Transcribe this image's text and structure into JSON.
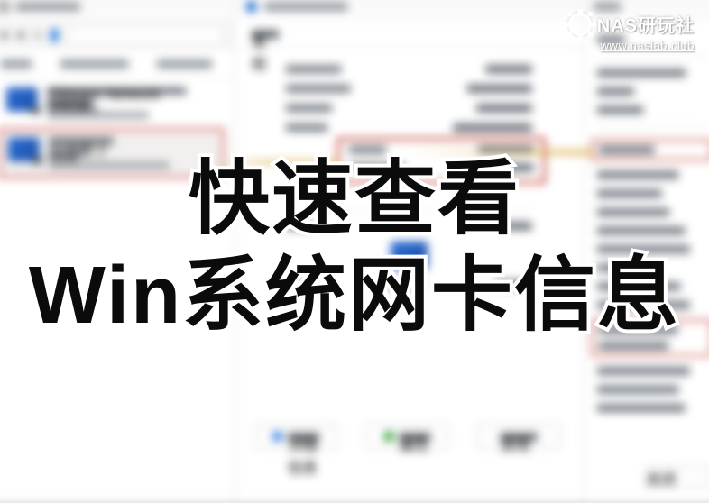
{
  "watermark": {
    "brand": "NAS研玩社",
    "url": "www.naslab.club"
  },
  "headline": {
    "line1": "快速查看",
    "line2": "Win系统网卡信息"
  },
  "left_panel": {
    "adapters": [
      {
        "name": "VMware Network Adapter",
        "sub": "VMnet"
      },
      {
        "name": "以太网 2",
        "sub": "网络"
      }
    ]
  },
  "mid_panel": {
    "tab": "常规",
    "buttons": [
      "详细信息",
      "属性",
      "禁用"
    ]
  },
  "right_panel": {
    "close": "关闭"
  }
}
